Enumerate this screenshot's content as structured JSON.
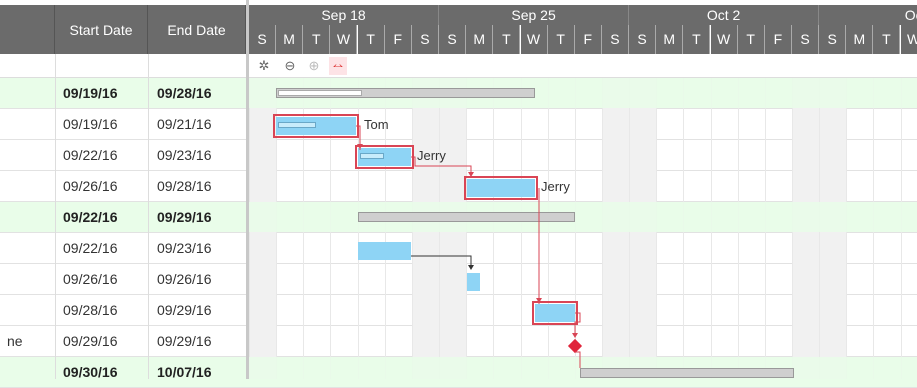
{
  "columns": {
    "start": "Start Date",
    "end": "End Date"
  },
  "weeks": [
    "Sep 18",
    "Sep 25",
    "Oct 2",
    "Oc"
  ],
  "days": [
    "S",
    "M",
    "T",
    "W",
    "T",
    "F",
    "S",
    "S",
    "M",
    "T",
    "W",
    "T",
    "F",
    "S",
    "S",
    "M",
    "T",
    "W",
    "T",
    "F",
    "S",
    "S",
    "M",
    "T",
    "W"
  ],
  "toolbar": {
    "settings": "settings-icon",
    "zoom_out": "zoom-out-icon",
    "zoom_in": "zoom-in-icon",
    "critical_path": "critical-path-icon"
  },
  "rows": [
    {
      "name": "",
      "start": "09/19/16",
      "end": "09/28/16",
      "summary": true
    },
    {
      "name": "",
      "start": "09/19/16",
      "end": "09/21/16",
      "summary": false,
      "resource": "Tom"
    },
    {
      "name": "",
      "start": "09/22/16",
      "end": "09/23/16",
      "summary": false,
      "resource": "Jerry"
    },
    {
      "name": "",
      "start": "09/26/16",
      "end": "09/28/16",
      "summary": false,
      "resource": "Jerry"
    },
    {
      "name": "",
      "start": "09/22/16",
      "end": "09/29/16",
      "summary": true
    },
    {
      "name": "",
      "start": "09/22/16",
      "end": "09/23/16",
      "summary": false
    },
    {
      "name": "",
      "start": "09/26/16",
      "end": "09/26/16",
      "summary": false
    },
    {
      "name": "",
      "start": "09/28/16",
      "end": "09/29/16",
      "summary": false
    },
    {
      "name": "ne",
      "start": "09/29/16",
      "end": "09/29/16",
      "summary": false
    },
    {
      "name": "",
      "start": "09/30/16",
      "end": "10/07/16",
      "summary": true
    }
  ],
  "colors": {
    "header": "#6b6b6b",
    "summary_row": "#e9fde9",
    "task_bar": "#8ed4f5",
    "critical": "#d94555"
  }
}
